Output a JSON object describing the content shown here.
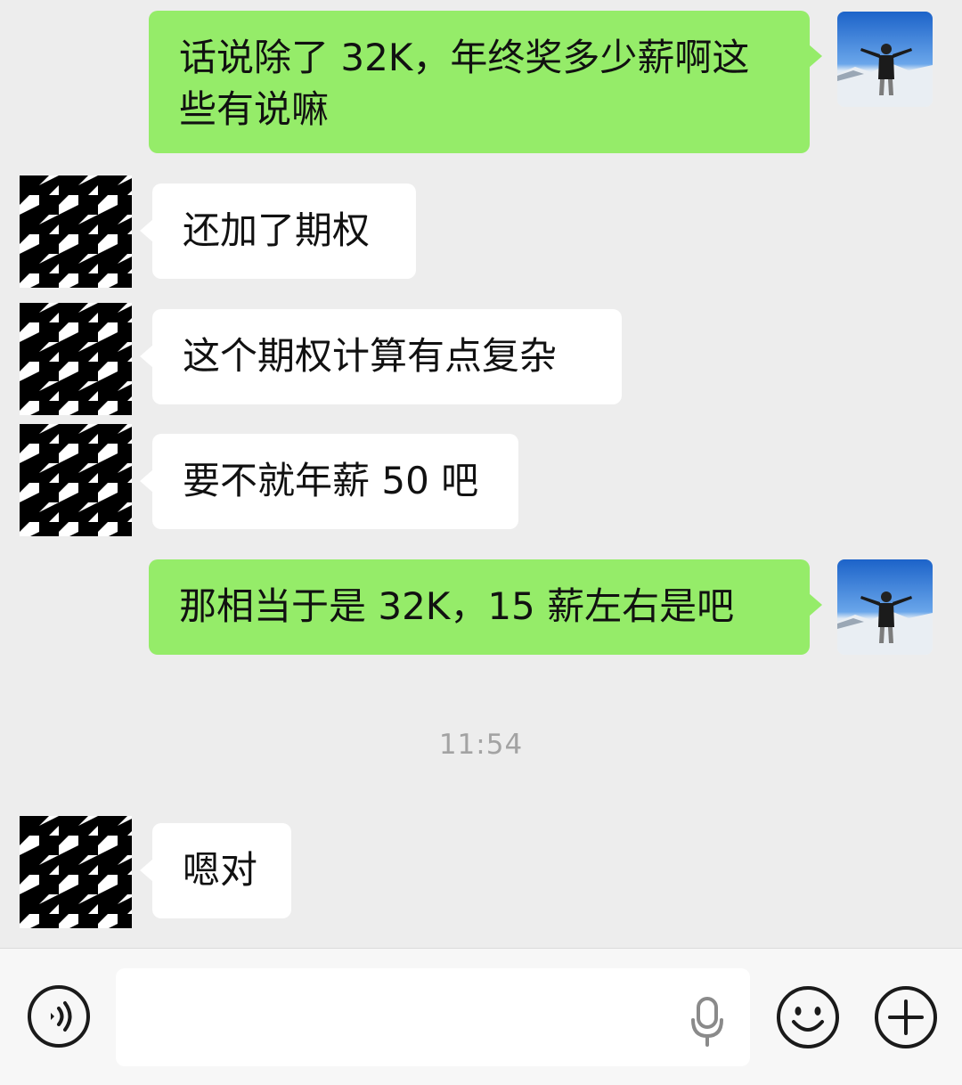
{
  "messages": [
    {
      "side": "me",
      "text": "话说除了 32K，年终奖多少薪啊这些有说嘛"
    },
    {
      "side": "them",
      "text": "还加了期权"
    },
    {
      "side": "them",
      "text": "这个期权计算有点复杂"
    },
    {
      "side": "them",
      "text": "要不就年薪 50 吧"
    },
    {
      "side": "me",
      "text": "那相当于是 32K，15 薪左右是吧"
    },
    {
      "side": "them",
      "text": "嗯对"
    }
  ],
  "timestamp": "11:54",
  "input": {
    "value": "",
    "placeholder": ""
  },
  "icons": {
    "voice": "voice-mode-icon",
    "mic": "microphone-icon",
    "emoji": "emoji-icon",
    "more": "plus-icon"
  },
  "colors": {
    "background": "#ededed",
    "my_bubble": "#95ec69",
    "their_bubble": "#ffffff",
    "timestamp": "#a3a3a3"
  }
}
